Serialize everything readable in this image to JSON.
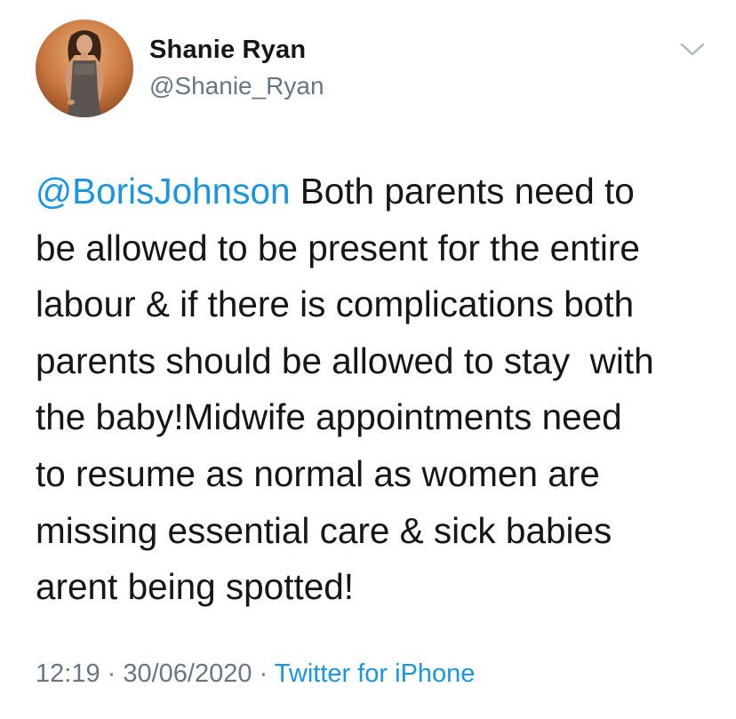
{
  "author": {
    "name": "Shanie Ryan",
    "handle": "@Shanie_Ryan",
    "avatar_icon": "profile-photo"
  },
  "menu_icon": "chevron-down-icon",
  "tweet": {
    "mention": "@BorisJohnson",
    "lines": [
      " Both parents need to",
      "be allowed to be present for the entire",
      "labour & if there is complications both",
      "parents should be allowed to stay  with",
      "the baby!Midwife appointments need",
      "to resume as normal as women are",
      "missing essential care & sick babies",
      "arent being spotted!"
    ]
  },
  "meta": {
    "time": "12:19",
    "separator": " · ",
    "date": "30/06/2020",
    "source": "Twitter for iPhone"
  },
  "colors": {
    "link": "#1b95e0",
    "secondary_text": "#657786",
    "primary_text": "#14171a"
  }
}
